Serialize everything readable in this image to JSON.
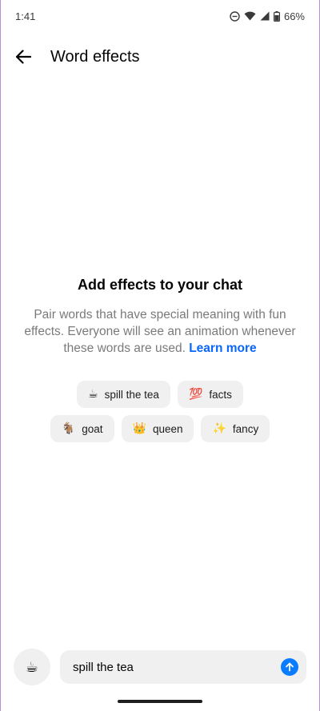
{
  "status_bar": {
    "time": "1:41",
    "battery": "66%",
    "icons": [
      "do-not-disturb-icon",
      "wifi-icon",
      "signal-icon",
      "battery-icon"
    ]
  },
  "header": {
    "back_icon": "arrow-left-icon",
    "title": "Word effects"
  },
  "content": {
    "heading": "Add effects to your chat",
    "description": "Pair words that have special meaning with fun effects. Everyone will see an animation whenever these words are used.",
    "learn_more": "Learn more"
  },
  "chips": {
    "row1": [
      {
        "emoji": "☕",
        "label": "spill the tea"
      },
      {
        "emoji": "💯",
        "label": "facts"
      }
    ],
    "row2": [
      {
        "emoji": "🐐",
        "label": "goat"
      },
      {
        "emoji": "👑",
        "label": "queen"
      },
      {
        "emoji": "✨",
        "label": "fancy"
      }
    ]
  },
  "composer": {
    "emoji": "☕",
    "input_value": "spill the tea",
    "send_icon": "send-arrow-up-icon"
  },
  "colors": {
    "accent": "#0866ff",
    "send": "#0a7cff",
    "chip_bg": "#f0f0f0"
  }
}
